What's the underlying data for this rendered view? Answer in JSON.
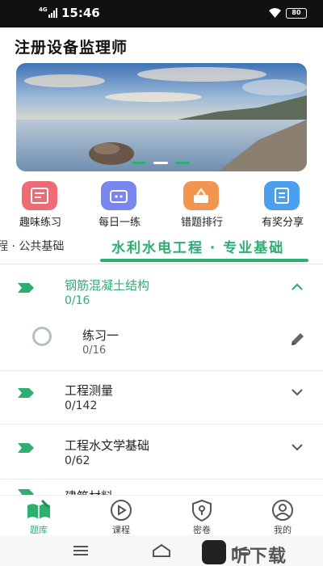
{
  "status_bar": {
    "network": "4G",
    "time": "15:46",
    "battery": "80"
  },
  "page_title": "注册设备监理师",
  "quick_actions": [
    {
      "label": "趣味练习",
      "icon": "fun-practice-icon",
      "color": "#ef6b73"
    },
    {
      "label": "每日一练",
      "icon": "daily-practice-icon",
      "color": "#7a86f0"
    },
    {
      "label": "错题排行",
      "icon": "wrong-ranking-icon",
      "color": "#f2954f"
    },
    {
      "label": "有奖分享",
      "icon": "share-reward-icon",
      "color": "#4aa0ee"
    }
  ],
  "tabs": {
    "left": "程 · 公共基础",
    "active": "水利水电工程 · 专业基础"
  },
  "chapters": [
    {
      "name": "钢筋混凝土结构",
      "count": "0/16",
      "expanded": true
    },
    {
      "name": "工程测量",
      "count": "0/142",
      "expanded": false
    },
    {
      "name": "工程水文学基础",
      "count": "0/62",
      "expanded": false
    },
    {
      "name": "建筑材料",
      "count": "",
      "expanded": false
    }
  ],
  "exercise": {
    "name": "练习一",
    "count": "0/16"
  },
  "bottom_nav": [
    {
      "label": "题库",
      "active": true
    },
    {
      "label": "课程",
      "active": false
    },
    {
      "label": "密卷",
      "active": false
    },
    {
      "label": "我的",
      "active": false
    }
  ],
  "watermark": "听下载",
  "colors": {
    "accent": "#2fae72"
  }
}
